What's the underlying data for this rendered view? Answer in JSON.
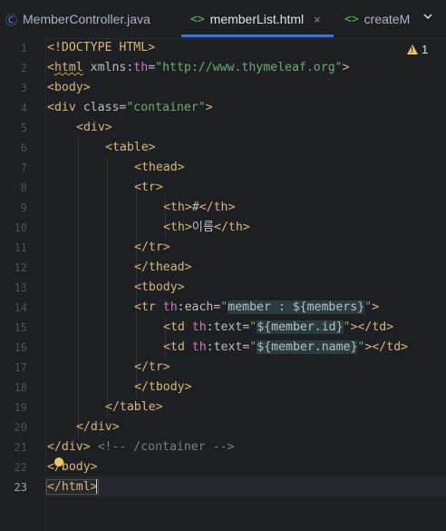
{
  "tabs": [
    {
      "label": "MemberController.java",
      "icon": "java-class-icon"
    },
    {
      "label": "memberList.html",
      "icon": "html-file-icon",
      "close": "×"
    },
    {
      "label": "createM",
      "icon": "html-file-icon"
    }
  ],
  "inspection": {
    "count": "1"
  },
  "line_numbers": [
    "1",
    "2",
    "3",
    "4",
    "5",
    "6",
    "7",
    "8",
    "9",
    "10",
    "11",
    "12",
    "13",
    "14",
    "15",
    "16",
    "17",
    "18",
    "19",
    "20",
    "21",
    "22",
    "23"
  ],
  "code": {
    "l1": "<!DOCTYPE HTML>",
    "l2_open": "<",
    "l2_tag": "html",
    "l2_attr": " xmlns:",
    "l2_ns": "th",
    "l2_eq": "=",
    "l2_val": "\"http://www.thymeleaf.org\"",
    "l2_close": ">",
    "l3": "<body>",
    "l4_tag": "<div",
    "l4_attr": " class=",
    "l4_val": "\"container\"",
    "l4_close": ">",
    "l5": "<div>",
    "l6": "<table>",
    "l7": "<thead>",
    "l8": "<tr>",
    "l9_open": "<th>",
    "l9_text": "#",
    "l9_close": "</th>",
    "l10_open": "<th>",
    "l10_text": "이름",
    "l10_close": "</th>",
    "l11": "</tr>",
    "l12": "</thead>",
    "l13": "<tbody>",
    "l14_tag": "<tr",
    "l14_ns": " th",
    "l14_attr": ":each=",
    "l14_q1": "\"",
    "l14_expr": "member : ${members}",
    "l14_q2": "\"",
    "l14_close": ">",
    "l15_tag": "<td",
    "l15_ns": " th",
    "l15_attr": ":text=",
    "l15_q1": "\"",
    "l15_expr": "${member.id}",
    "l15_q2": "\"",
    "l15_close": "></td>",
    "l16_tag": "<td",
    "l16_ns": " th",
    "l16_attr": ":text=",
    "l16_q1": "\"",
    "l16_expr": "${member.name}",
    "l16_q2": "\"",
    "l16_close": "></td>",
    "l17": "</tr>",
    "l18": "</tbody>",
    "l19": "</table>",
    "l20": "</div>",
    "l21_tag": "</div>",
    "l21_comment": " <!-- /container -->",
    "l22": "</body>",
    "l23": "</html>"
  }
}
